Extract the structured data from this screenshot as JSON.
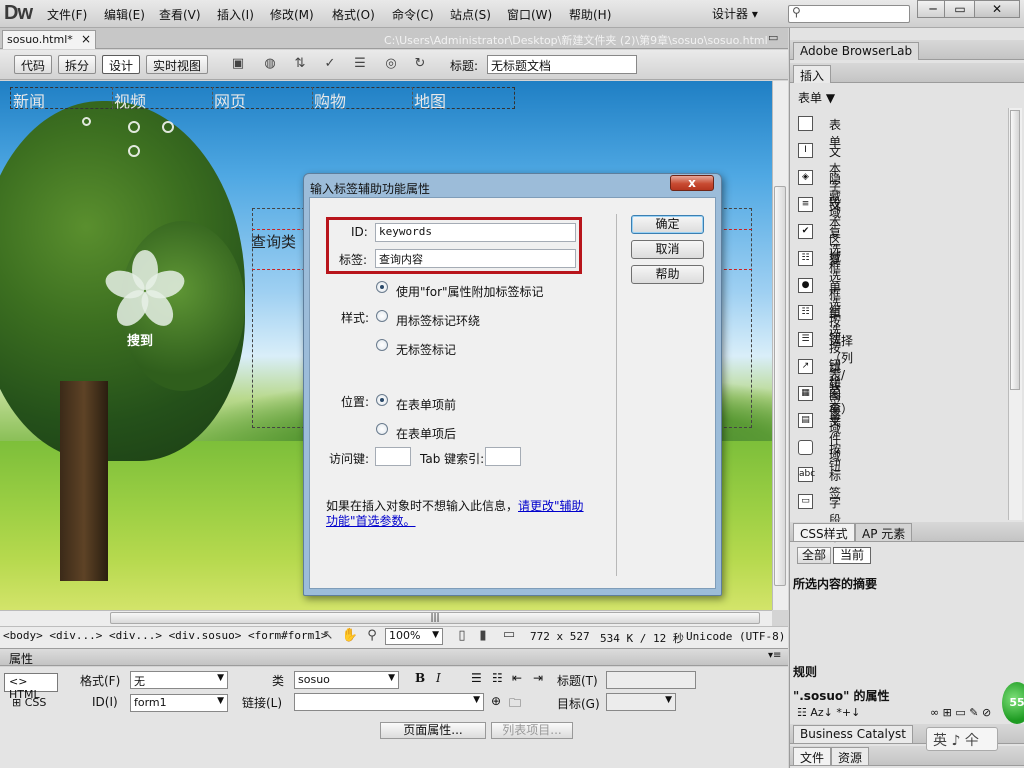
{
  "app": {
    "logo": "Dw"
  },
  "menu": [
    "文件(F)",
    "编辑(E)",
    "查看(V)",
    "插入(I)",
    "修改(M)",
    "格式(O)",
    "命令(C)",
    "站点(S)",
    "窗口(W)",
    "帮助(H)"
  ],
  "layout_switcher": "设计器 ▾",
  "search": {
    "icon": "search-icon"
  },
  "window_buttons": [
    "─",
    "▭",
    "✕"
  ],
  "doc_tab": {
    "name": "sosuo.html*",
    "close": "×"
  },
  "doc_path": "C:\\Users\\Administrator\\Desktop\\新建文件夹 (2)\\第9章\\sosuo\\sosuo.html",
  "doc_restore": "▭",
  "view_buttons": [
    "代码",
    "拆分",
    "设计",
    "实时视图"
  ],
  "toolbar_title": {
    "label": "标题:",
    "value": "无标题文档"
  },
  "design": {
    "nav": [
      "新闻",
      "视频",
      "网页",
      "购物",
      "地图"
    ],
    "query_label": "查询类",
    "logo_text": "搜到",
    "hscroll_grip": "|||"
  },
  "status": {
    "tag_selector": "<body> <div...> <div...> <div.sosuo> <form#form1>",
    "zoom": "100%",
    "window_size": "772 x 527",
    "file_size": "534 K / 12 秒",
    "encoding": "Unicode (UTF-8)"
  },
  "properties": {
    "title": "属性",
    "html_btn": "HTML",
    "css_btn": "CSS",
    "format_label": "格式(F)",
    "format_value": "无",
    "class_label": "类",
    "class_value": "sosuo",
    "bold": "B",
    "italic": "I",
    "title_label": "标题(T)",
    "id_label": "ID(I)",
    "id_value": "form1",
    "link_label": "链接(L)",
    "target_label": "目标(G)",
    "page_props_btn": "页面属性...",
    "list_item_btn": "列表项目..."
  },
  "right_panel": {
    "browserlab": "Adobe BrowserLab",
    "insert_tab": "插入",
    "category": "表单",
    "insert_items": [
      {
        "icon": "form-icon",
        "label": "表单"
      },
      {
        "icon": "text-field-icon",
        "label": "文本字段"
      },
      {
        "icon": "hidden-field-icon",
        "label": "隐藏域"
      },
      {
        "icon": "textarea-icon",
        "label": "文本区域"
      },
      {
        "icon": "checkbox-icon",
        "label": "复选框"
      },
      {
        "icon": "checkbox-group-icon",
        "label": "复选框组"
      },
      {
        "icon": "radio-button-icon",
        "label": "单选按钮"
      },
      {
        "icon": "radio-group-icon",
        "label": "单选按钮组"
      },
      {
        "icon": "select-list-icon",
        "label": "选择（列表/菜单）"
      },
      {
        "icon": "jump-menu-icon",
        "label": "跳转菜单"
      },
      {
        "icon": "image-field-icon",
        "label": "图像域"
      },
      {
        "icon": "file-field-icon",
        "label": "文件域"
      },
      {
        "icon": "button-icon",
        "label": "按钮"
      },
      {
        "icon": "label-icon",
        "label": "标签"
      },
      {
        "icon": "fieldset-icon",
        "label": "字段集"
      }
    ],
    "css_tabs": [
      "CSS样式",
      "AP 元素"
    ],
    "css_mode": [
      "全部",
      "当前"
    ],
    "summary_title": "所选内容的摘要",
    "rules_label": "规则",
    "props_of": "\".sosuo\" 的属性",
    "business_catalyst": "Business Catalyst",
    "bottom_tabs": [
      "文件",
      "资源"
    ]
  },
  "dialog": {
    "title": "输入标签辅助功能属性",
    "close": "x",
    "id_label": "ID:",
    "id_value": "keywords",
    "label_label": "标签:",
    "label_value": "查询内容",
    "style_label": "样式:",
    "style_options": [
      {
        "label": "使用\"for\"属性附加标签标记",
        "selected": true
      },
      {
        "label": "用标签标记环绕",
        "selected": false
      },
      {
        "label": "无标签标记",
        "selected": false
      }
    ],
    "position_label": "位置:",
    "position_options": [
      {
        "label": "在表单项前",
        "selected": true
      },
      {
        "label": "在表单项后",
        "selected": false
      }
    ],
    "access_key_label": "访问键:",
    "tab_index_label": "Tab 键索引:",
    "ok": "确定",
    "cancel": "取消",
    "help": "帮助",
    "info_text": "如果在插入对象时不想输入此信息，",
    "info_link": "请更改\"辅助功能\"首选参数。"
  },
  "ime": "英 ♪ 仐",
  "badge": "55",
  "colors": {
    "highlight_red": "#b8151b",
    "dialog_frame": "#9cbcd9",
    "link_blue": "#0000cc"
  }
}
